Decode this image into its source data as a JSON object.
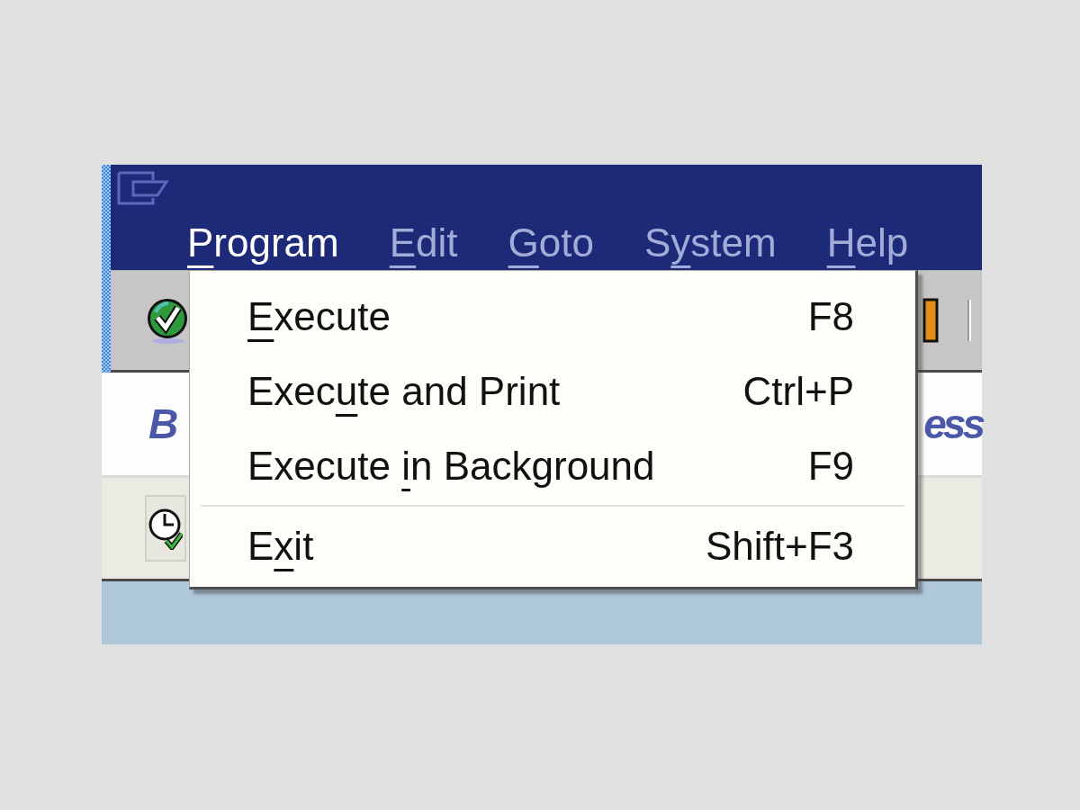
{
  "window": {
    "menu_bar": [
      {
        "access_key": "P",
        "label_end": "rogram",
        "selected": true
      },
      {
        "access_key": "E",
        "label_end": "dit",
        "selected": false
      },
      {
        "access_key": "G",
        "label_end": "oto",
        "selected": false
      },
      {
        "label_start": "S",
        "access_key": "y",
        "label_end": "stem",
        "selected": false
      },
      {
        "access_key": "H",
        "label_end": "elp",
        "selected": false
      }
    ]
  },
  "open_menu": {
    "items": [
      {
        "kind": "command",
        "access_key": "E",
        "label_end": "xecute",
        "shortcut": "F8"
      },
      {
        "kind": "command",
        "label_start": "Exec",
        "access_key": "u",
        "label_end": "te and Print",
        "shortcut": "Ctrl+P"
      },
      {
        "kind": "command",
        "label_start": "Execute ",
        "access_key": "i",
        "label_end": "n Background",
        "shortcut": "F9"
      },
      {
        "kind": "separator"
      },
      {
        "kind": "command",
        "label_start": "E",
        "access_key": "x",
        "label_end": "it",
        "shortcut": "Shift+F3"
      }
    ]
  },
  "page_title": {
    "visible_start": "B",
    "visible_end": "ess"
  }
}
